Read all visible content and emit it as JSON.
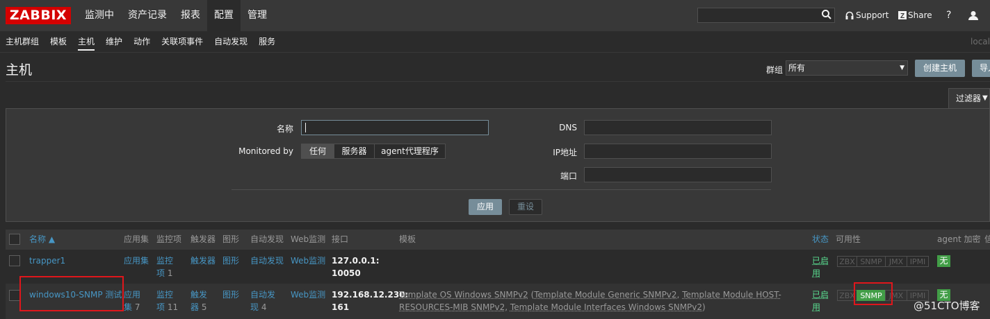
{
  "header": {
    "logo": "ZABBIX",
    "menu": [
      "监测中",
      "资产记录",
      "报表",
      "配置",
      "管理"
    ],
    "active_menu_index": 3,
    "search_placeholder": "",
    "support": "Support",
    "share": "Share",
    "help": "?"
  },
  "submenu": {
    "items": [
      "主机群组",
      "模板",
      "主机",
      "维护",
      "动作",
      "关联项事件",
      "自动发现",
      "服务"
    ],
    "active_index": 2,
    "right_text": "local"
  },
  "page": {
    "title": "主机",
    "group_label": "群组",
    "group_value": "所有",
    "create_host_button": "创建主机",
    "import_button": "导入"
  },
  "filter": {
    "tab_label": "过滤器",
    "name_label": "名称",
    "name_value": "",
    "monitored_by_label": "Monitored by",
    "monitored_by_options": [
      "任何",
      "服务器",
      "agent代理程序"
    ],
    "monitored_by_selected": 0,
    "dns_label": "DNS",
    "ip_label": "IP地址",
    "port_label": "端口",
    "apply_button": "应用",
    "reset_button": "重设"
  },
  "table": {
    "columns": {
      "name": "名称 ▲",
      "apps": "应用集",
      "items": "监控项",
      "triggers": "触发器",
      "graphs": "图形",
      "discovery": "自动发现",
      "web": "Web监测",
      "interface": "接口",
      "templates": "模板",
      "status": "状态",
      "availability": "可用性",
      "agent_encryption": "agent 加密",
      "info": "信"
    },
    "rows": [
      {
        "name": "trapper1",
        "apps": "应用集",
        "apps_count": "",
        "items_line1": "监控",
        "items_line2": "项",
        "items_count": "1",
        "triggers": "触发器",
        "triggers_count": "",
        "graphs": "图形",
        "discovery": "自动发现",
        "discovery_count": "",
        "web": "Web监测",
        "interface_line1": "127.0.0.1:",
        "interface_line2": "10050",
        "templates_line1": "",
        "templates_line2": "",
        "status_line1": "已启",
        "status_line2": "用",
        "availability": [
          "ZBX",
          "SNMP",
          "JMX",
          "IPMI"
        ],
        "availability_active": [],
        "encryption": "无"
      },
      {
        "name": "windows10-SNMP 测试",
        "apps": "应用",
        "apps_line2": "集",
        "apps_count": "7",
        "items_line1": "监控",
        "items_line2": "项",
        "items_count": "11",
        "triggers_line1": "触发",
        "triggers_line2": "器",
        "triggers_count": "5",
        "graphs": "图形",
        "discovery_line1": "自动发",
        "discovery_line2": "现",
        "discovery_count": "4",
        "web": "Web监测",
        "interface_line1": "192.168.12.230:",
        "interface_line2": "161",
        "template_main": "Template OS Windows SNMPv2",
        "template_paren_open": " (",
        "template_sub1": "Template Module Generic SNMPv2",
        "template_comma1": ", ",
        "template_sub2a": "Template Module HOST-",
        "template_sub2b": "RESOURCES-MIB SNMPv2",
        "template_comma2": ", ",
        "template_sub3": "Template Module Interfaces Windows SNMPv2",
        "template_paren_close": ")",
        "status_line1": "已启",
        "status_line2": "用",
        "availability": [
          "ZBX",
          "SNMP",
          "JMX",
          "IPMI"
        ],
        "availability_active": [
          "SNMP"
        ],
        "encryption": "无"
      }
    ]
  },
  "watermark": "@51CTO博客",
  "colors": {
    "brand_red": "#d40000",
    "link": "#4796c4",
    "enabled_green": "#59db8f",
    "badge_green": "#429e47",
    "highlight_red": "#e0161b"
  }
}
